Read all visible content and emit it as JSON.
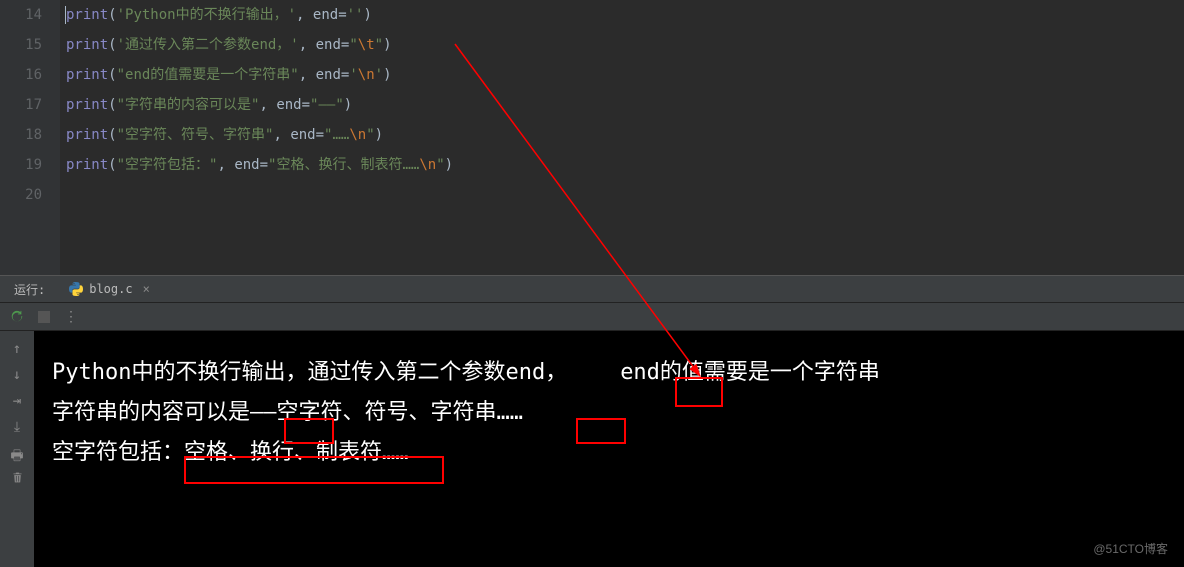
{
  "gutter": [
    "14",
    "15",
    "16",
    "17",
    "18",
    "19",
    "20"
  ],
  "code": {
    "l14": {
      "fn": "print",
      "paren_open": "(",
      "s": "'Python中的不换行输出，'",
      "comma": ", ",
      "kw": "end",
      "eq": "=",
      "v": "''",
      "paren_close": ")"
    },
    "l15": {
      "fn": "print",
      "paren_open": "(",
      "s": "'通过传入第二个参数end，'",
      "comma": ", ",
      "kw": "end",
      "eq": "=",
      "q1": "\"",
      "esc": "\\t",
      "q2": "\"",
      "paren_close": ")"
    },
    "l16": {
      "fn": "print",
      "paren_open": "(",
      "s": "\"end的值需要是一个字符串\"",
      "comma": ", ",
      "kw": "end",
      "eq": "=",
      "q1": "'",
      "esc": "\\n",
      "q2": "'",
      "paren_close": ")"
    },
    "l17": {
      "fn": "print",
      "paren_open": "(",
      "s": "\"字符串的内容可以是\"",
      "comma": ", ",
      "kw": "end",
      "eq": "=",
      "v": "\"——\"",
      "paren_close": ")"
    },
    "l18": {
      "fn": "print",
      "paren_open": "(",
      "s": "\"空字符、符号、字符串\"",
      "comma": ", ",
      "kw": "end",
      "eq": "=",
      "q1": "\"",
      "pre": "……",
      "esc": "\\n",
      "q2": "\"",
      "paren_close": ")"
    },
    "l19": {
      "fn": "print",
      "paren_open": "(",
      "s": "\"空字符包括：\"",
      "comma": ", ",
      "kw": "end",
      "eq": "=",
      "q1": "\"",
      "pre": "空格、换行、制表符……",
      "esc": "\\n",
      "q2": "\"",
      "paren_close": ")"
    }
  },
  "panel": {
    "run_label": "运行:",
    "tab_name": "blog.c",
    "close": "×"
  },
  "console": {
    "line1": "Python中的不换行输出，通过传入第二个参数end，    end的值需要是一个字符串",
    "line2": "字符串的内容可以是——空字符、符号、字符串……",
    "line3": "空字符包括：空格、换行、制表符……"
  },
  "watermark": "@51CTO博客"
}
